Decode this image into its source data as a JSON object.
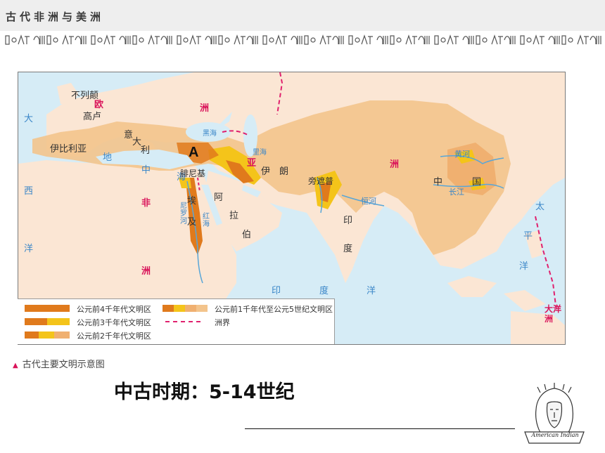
{
  "header": {
    "title": "古代非洲与美洲"
  },
  "map": {
    "marker": "A",
    "regions": {
      "europe_ou": "欧",
      "europe_zhou": "洲",
      "asia_ya": "亚",
      "asia_zhou": "洲",
      "africa_fei": "非",
      "africa_zhou": "洲",
      "oceania": "大洋洲"
    },
    "places": {
      "britain": "不列颠",
      "gaul": "高卢",
      "iberia": "伊比利亚",
      "italy_yi": "意",
      "italy_da": "大",
      "italy_li": "利",
      "phoenicia": "腓尼基",
      "egypt_ai": "埃",
      "egypt_ji": "及",
      "persia": "伊　朗",
      "arabia_a": "阿",
      "arabia_la": "拉",
      "arabia_bo": "伯",
      "punjab": "旁遮普",
      "india_yin": "印",
      "india_du": "度",
      "china_zhong": "中",
      "china_guo": "国",
      "huang_he": "黄河",
      "chang_jiang": "长江",
      "ganges": "恒河",
      "nile": "尼罗河",
      "black_sea": "黑海",
      "caspian": "里海",
      "red_sea": "红海",
      "med_di": "地",
      "med_zhong": "中",
      "med_hai": "海"
    },
    "oceans": {
      "atlantic_da": "大",
      "atlantic_xi": "西",
      "atlantic_yang": "洋",
      "indian_yin": "印",
      "indian_du": "度",
      "indian_yang": "洋",
      "pacific_tai": "太",
      "pacific_ping": "平",
      "pacific_yang": "洋"
    },
    "legend": {
      "row1": "公元前4千年代文明区",
      "row2": "公元前3千年代文明区",
      "row3": "公元前2千年代文明区",
      "row4": "公元前1千年代至公元5世纪文明区",
      "row5": "洲界"
    },
    "colors": {
      "sea": "#d6ecf6",
      "land": "#fbe6d4",
      "civ_late": "#f3c48c",
      "civ_2k": "#f0b070",
      "civ_3k": "#f4c41a",
      "civ_4k": "#e07a1c",
      "boundary": "#e0216e",
      "river": "#58a6d8"
    }
  },
  "caption": "古代主要文明示意图",
  "subtitle": "中古时期：5-14世纪",
  "logo": {
    "text": "American Indian"
  }
}
